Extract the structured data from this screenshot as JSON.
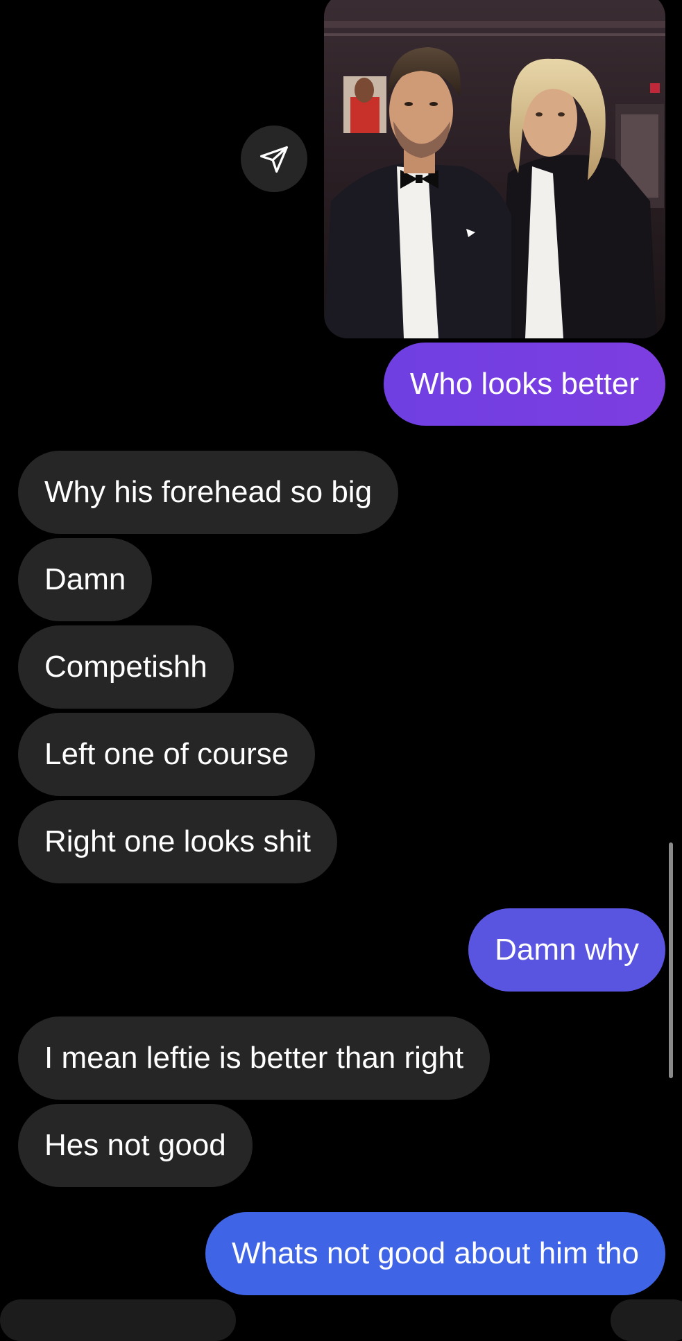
{
  "conversation": {
    "shared_photo": {
      "alt": "Two men in tuxedos",
      "share_icon": "paper-plane-icon"
    },
    "messages": [
      {
        "side": "outgoing",
        "text": "Who looks better"
      },
      {
        "side": "incoming",
        "text": "Why his forehead so big"
      },
      {
        "side": "incoming",
        "text": "Damn"
      },
      {
        "side": "incoming",
        "text": "Competishh"
      },
      {
        "side": "incoming",
        "text": "Left one of course"
      },
      {
        "side": "incoming",
        "text": "Right one looks shit"
      },
      {
        "side": "outgoing",
        "text": "Damn why"
      },
      {
        "side": "incoming",
        "text": "I mean leftie is better than right"
      },
      {
        "side": "incoming",
        "text": "Hes not good"
      },
      {
        "side": "outgoing",
        "text": "Whats not good about him tho"
      }
    ]
  },
  "colors": {
    "background": "#000000",
    "incoming_bubble": "#262626",
    "outgoing_bubble_top": "#7d3ee0",
    "outgoing_bubble_mid": "#5a55e0",
    "outgoing_bubble_bottom": "#4064e6"
  }
}
